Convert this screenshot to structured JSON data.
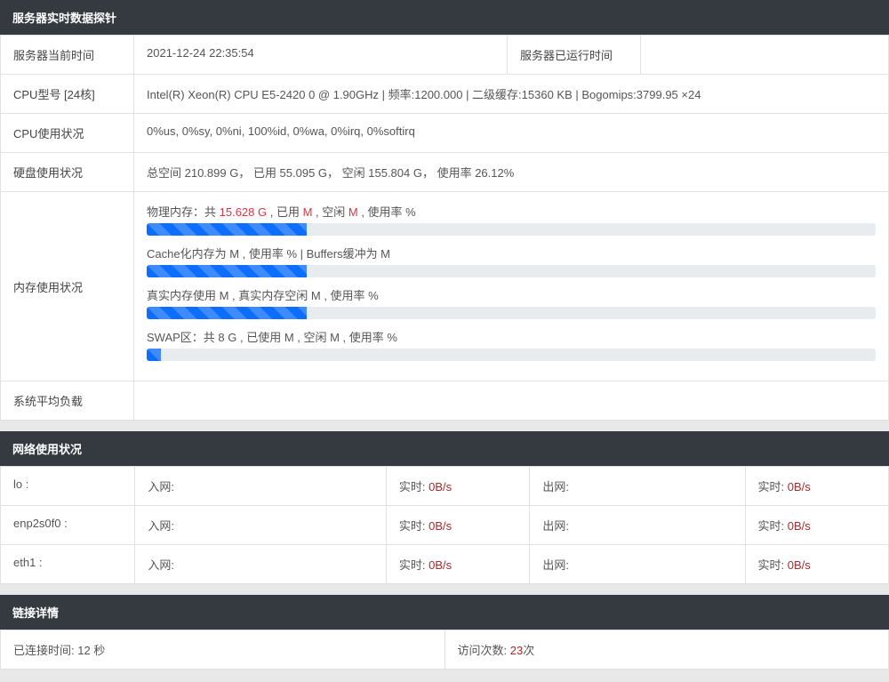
{
  "panel1": {
    "title": "服务器实时数据探针",
    "row_time": {
      "label1": "服务器当前时间",
      "value1": "2021-12-24 22:35:54",
      "label2": "服务器已运行时间",
      "value2": ""
    },
    "row_cpu_model": {
      "label": "CPU型号 [24核]",
      "value": "Intel(R) Xeon(R) CPU E5-2420 0 @ 1.90GHz | 频率:1200.000 | 二级缓存:15360 KB | Bogomips:3799.95 ×24"
    },
    "row_cpu_usage": {
      "label": "CPU使用状况",
      "value": "0%us, 0%sy, 0%ni, 100%id, 0%wa, 0%irq, 0%softirq"
    },
    "row_disk": {
      "label": "硬盘使用状况",
      "value": "总空间 210.899 G， 已用 55.095 G， 空闲 155.804 G， 使用率 26.12%"
    },
    "row_mem": {
      "label": "内存使用状况",
      "phys_prefix": "物理内存：共 ",
      "phys_total": "15.628 G",
      "phys_mid1": " , 已用 ",
      "phys_used": "M",
      "phys_mid2": " , 空闲 ",
      "phys_free": "M",
      "phys_mid3": " , 使用率 ",
      "phys_rate": "%",
      "phys_bar": 22,
      "cache_text": "Cache化内存为 M , 使用率 % | Buffers缓冲为 M",
      "cache_bar": 22,
      "real_text": "真实内存使用 M , 真实内存空闲 M , 使用率 %",
      "real_bar": 22,
      "swap_text": "SWAP区：共 8 G , 已使用 M , 空闲 M , 使用率 %",
      "swap_bar": 2
    },
    "row_load": {
      "label": "系统平均负载",
      "value": ""
    }
  },
  "panel2": {
    "title": "网络使用状况",
    "in_label": "入网:",
    "out_label": "出网:",
    "rt_label": "实时: ",
    "ifaces": [
      {
        "name": "lo :",
        "in_rt": "0B/s",
        "out_rt": "0B/s"
      },
      {
        "name": "enp2s0f0 :",
        "in_rt": "0B/s",
        "out_rt": "0B/s"
      },
      {
        "name": "eth1 :",
        "in_rt": "0B/s",
        "out_rt": "0B/s"
      }
    ]
  },
  "panel3": {
    "title": "链接详情",
    "conn_label": "已连接时间: ",
    "conn_value": "12 秒",
    "visit_label": "访问次数: ",
    "visit_value": "23",
    "visit_suffix": "次"
  }
}
